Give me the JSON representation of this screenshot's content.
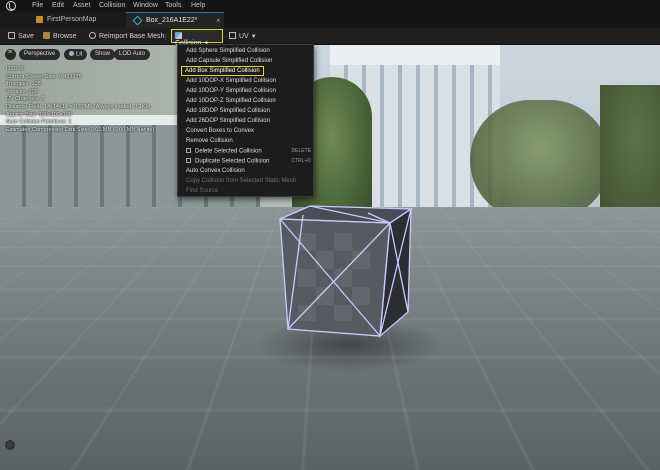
{
  "menubar": {
    "items": [
      "File",
      "Edit",
      "Asset",
      "Collision",
      "Window",
      "Tools",
      "Help"
    ]
  },
  "tabs": {
    "map": "FirstPersonMap",
    "asset": "Box_216A1E22*",
    "close": "×"
  },
  "toolbar": {
    "save": "Save",
    "browse": "Browse",
    "reimport": "Reimport Base Mesh",
    "more": "⋮",
    "collision": "Collision",
    "uv": "UV"
  },
  "viewport": {
    "perspective": "Perspective",
    "lit": "Lit",
    "show": "Show",
    "lod": "LOD Auto",
    "stats": [
      "LOD:  0",
      "Current Screen Size:  0.433375",
      "Triangles:  108",
      "Vertices:  208",
      "UV Channels:  1",
      "Distance Field:  14x14x14 = 0.00Mb (Always loaded, 0.1Kb)",
      "Approx Size:  100x100x100",
      "Num Collision Primitives:  1",
      "Estimated Compressed Disk Size:  0.01 MB (0.00 MB Nanite)"
    ]
  },
  "collision_menu": {
    "items": [
      {
        "label": "Add Sphere Simplified Collision",
        "state": "normal"
      },
      {
        "label": "Add Capsule Simplified Collision",
        "state": "normal"
      },
      {
        "label": "Add Box Simplified Collision",
        "state": "highlighted"
      },
      {
        "label": "Add 10DOP-X Simplified Collision",
        "state": "normal"
      },
      {
        "label": "Add 10DOP-Y Simplified Collision",
        "state": "normal"
      },
      {
        "label": "Add 10DOP-Z Simplified Collision",
        "state": "normal"
      },
      {
        "label": "Add 18DOP Simplified Collision",
        "state": "normal"
      },
      {
        "label": "Add 26DOP Simplified Collision",
        "state": "normal"
      },
      {
        "label": "Convert Boxes to Convex",
        "state": "normal"
      },
      {
        "label": "Remove Collision",
        "state": "normal"
      },
      {
        "label": "Delete Selected Collision",
        "state": "normal",
        "shortcut": "DELETE"
      },
      {
        "label": "Duplicate Selected Collision",
        "state": "normal",
        "shortcut": "CTRL+D"
      },
      {
        "label": "Auto Convex Collision",
        "state": "normal"
      },
      {
        "label": "Copy Collision from Selected Static Mesh",
        "state": "disabled"
      },
      {
        "label": "Find Source",
        "state": "disabled"
      }
    ]
  },
  "colors": {
    "highlight": "#e2d23a",
    "menu_bg": "#1c1c1c",
    "collision_wire": "#c9c8ff"
  }
}
